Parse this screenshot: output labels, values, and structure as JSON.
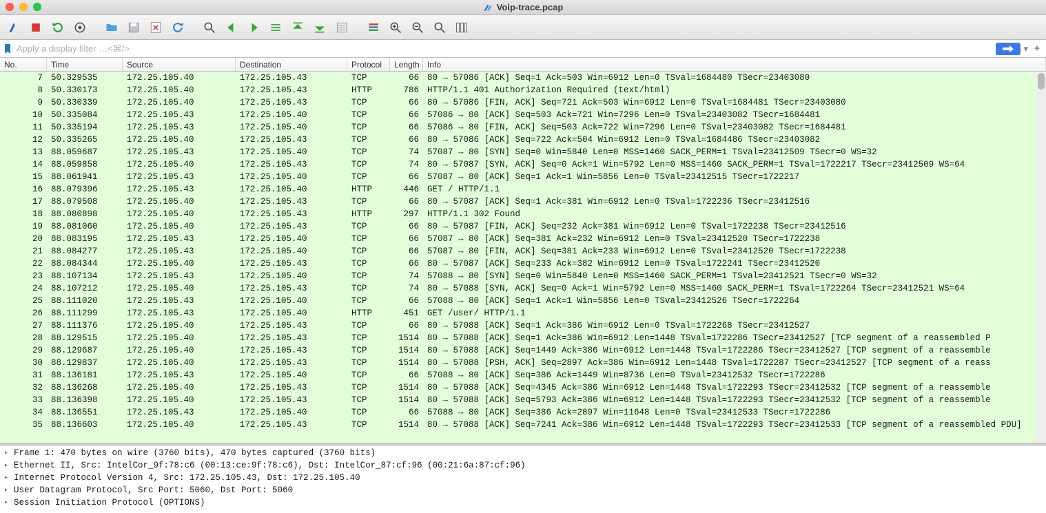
{
  "window": {
    "title": "Voip-trace.pcap"
  },
  "filter": {
    "placeholder": "Apply a display filter …<⌘/>"
  },
  "columns": {
    "no": "No.",
    "time": "Time",
    "source": "Source",
    "destination": "Destination",
    "protocol": "Protocol",
    "length": "Length",
    "info": "Info"
  },
  "packets": [
    {
      "no": 7,
      "time": "50.329535",
      "src": "172.25.105.40",
      "dst": "172.25.105.43",
      "proto": "TCP",
      "len": 66,
      "info": "80 → 57086 [ACK] Seq=1 Ack=503 Win=6912 Len=0 TSval=1684480 TSecr=23403080"
    },
    {
      "no": 8,
      "time": "50.330173",
      "src": "172.25.105.40",
      "dst": "172.25.105.43",
      "proto": "HTTP",
      "len": 786,
      "info": "HTTP/1.1 401 Authorization Required  (text/html)"
    },
    {
      "no": 9,
      "time": "50.330339",
      "src": "172.25.105.40",
      "dst": "172.25.105.43",
      "proto": "TCP",
      "len": 66,
      "info": "80 → 57086 [FIN, ACK] Seq=721 Ack=503 Win=6912 Len=0 TSval=1684481 TSecr=23403080"
    },
    {
      "no": 10,
      "time": "50.335084",
      "src": "172.25.105.43",
      "dst": "172.25.105.40",
      "proto": "TCP",
      "len": 66,
      "info": "57086 → 80 [ACK] Seq=503 Ack=721 Win=7296 Len=0 TSval=23403082 TSecr=1684481"
    },
    {
      "no": 11,
      "time": "50.335194",
      "src": "172.25.105.43",
      "dst": "172.25.105.40",
      "proto": "TCP",
      "len": 66,
      "info": "57086 → 80 [FIN, ACK] Seq=503 Ack=722 Win=7296 Len=0 TSval=23403082 TSecr=1684481"
    },
    {
      "no": 12,
      "time": "50.335265",
      "src": "172.25.105.40",
      "dst": "172.25.105.43",
      "proto": "TCP",
      "len": 66,
      "info": "80 → 57086 [ACK] Seq=722 Ack=504 Win=6912 Len=0 TSval=1684486 TSecr=23403082"
    },
    {
      "no": 13,
      "time": "88.059687",
      "src": "172.25.105.43",
      "dst": "172.25.105.40",
      "proto": "TCP",
      "len": 74,
      "info": "57087 → 80 [SYN] Seq=0 Win=5840 Len=0 MSS=1460 SACK_PERM=1 TSval=23412509 TSecr=0 WS=32"
    },
    {
      "no": 14,
      "time": "88.059858",
      "src": "172.25.105.40",
      "dst": "172.25.105.43",
      "proto": "TCP",
      "len": 74,
      "info": "80 → 57087 [SYN, ACK] Seq=0 Ack=1 Win=5792 Len=0 MSS=1460 SACK_PERM=1 TSval=1722217 TSecr=23412509 WS=64"
    },
    {
      "no": 15,
      "time": "88.061941",
      "src": "172.25.105.43",
      "dst": "172.25.105.40",
      "proto": "TCP",
      "len": 66,
      "info": "57087 → 80 [ACK] Seq=1 Ack=1 Win=5856 Len=0 TSval=23412515 TSecr=1722217"
    },
    {
      "no": 16,
      "time": "88.079396",
      "src": "172.25.105.43",
      "dst": "172.25.105.40",
      "proto": "HTTP",
      "len": 446,
      "info": "GET / HTTP/1.1"
    },
    {
      "no": 17,
      "time": "88.079508",
      "src": "172.25.105.40",
      "dst": "172.25.105.43",
      "proto": "TCP",
      "len": 66,
      "info": "80 → 57087 [ACK] Seq=1 Ack=381 Win=6912 Len=0 TSval=1722236 TSecr=23412516"
    },
    {
      "no": 18,
      "time": "88.080898",
      "src": "172.25.105.40",
      "dst": "172.25.105.43",
      "proto": "HTTP",
      "len": 297,
      "info": "HTTP/1.1 302 Found"
    },
    {
      "no": 19,
      "time": "88.081060",
      "src": "172.25.105.40",
      "dst": "172.25.105.43",
      "proto": "TCP",
      "len": 66,
      "info": "80 → 57087 [FIN, ACK] Seq=232 Ack=381 Win=6912 Len=0 TSval=1722238 TSecr=23412516"
    },
    {
      "no": 20,
      "time": "88.083195",
      "src": "172.25.105.43",
      "dst": "172.25.105.40",
      "proto": "TCP",
      "len": 66,
      "info": "57087 → 80 [ACK] Seq=381 Ack=232 Win=6912 Len=0 TSval=23412520 TSecr=1722238"
    },
    {
      "no": 21,
      "time": "88.084277",
      "src": "172.25.105.43",
      "dst": "172.25.105.40",
      "proto": "TCP",
      "len": 66,
      "info": "57087 → 80 [FIN, ACK] Seq=381 Ack=233 Win=6912 Len=0 TSval=23412520 TSecr=1722238"
    },
    {
      "no": 22,
      "time": "88.084344",
      "src": "172.25.105.40",
      "dst": "172.25.105.43",
      "proto": "TCP",
      "len": 66,
      "info": "80 → 57087 [ACK] Seq=233 Ack=382 Win=6912 Len=0 TSval=1722241 TSecr=23412520"
    },
    {
      "no": 23,
      "time": "88.107134",
      "src": "172.25.105.43",
      "dst": "172.25.105.40",
      "proto": "TCP",
      "len": 74,
      "info": "57088 → 80 [SYN] Seq=0 Win=5840 Len=0 MSS=1460 SACK_PERM=1 TSval=23412521 TSecr=0 WS=32"
    },
    {
      "no": 24,
      "time": "88.107212",
      "src": "172.25.105.40",
      "dst": "172.25.105.43",
      "proto": "TCP",
      "len": 74,
      "info": "80 → 57088 [SYN, ACK] Seq=0 Ack=1 Win=5792 Len=0 MSS=1460 SACK_PERM=1 TSval=1722264 TSecr=23412521 WS=64"
    },
    {
      "no": 25,
      "time": "88.111020",
      "src": "172.25.105.43",
      "dst": "172.25.105.40",
      "proto": "TCP",
      "len": 66,
      "info": "57088 → 80 [ACK] Seq=1 Ack=1 Win=5856 Len=0 TSval=23412526 TSecr=1722264"
    },
    {
      "no": 26,
      "time": "88.111299",
      "src": "172.25.105.43",
      "dst": "172.25.105.40",
      "proto": "HTTP",
      "len": 451,
      "info": "GET /user/ HTTP/1.1"
    },
    {
      "no": 27,
      "time": "88.111376",
      "src": "172.25.105.40",
      "dst": "172.25.105.43",
      "proto": "TCP",
      "len": 66,
      "info": "80 → 57088 [ACK] Seq=1 Ack=386 Win=6912 Len=0 TSval=1722268 TSecr=23412527"
    },
    {
      "no": 28,
      "time": "88.129515",
      "src": "172.25.105.40",
      "dst": "172.25.105.43",
      "proto": "TCP",
      "len": 1514,
      "info": "80 → 57088 [ACK] Seq=1 Ack=386 Win=6912 Len=1448 TSval=1722286 TSecr=23412527 [TCP segment of a reassembled P"
    },
    {
      "no": 29,
      "time": "88.129687",
      "src": "172.25.105.40",
      "dst": "172.25.105.43",
      "proto": "TCP",
      "len": 1514,
      "info": "80 → 57088 [ACK] Seq=1449 Ack=386 Win=6912 Len=1448 TSval=1722286 TSecr=23412527 [TCP segment of a reassemble"
    },
    {
      "no": 30,
      "time": "88.129837",
      "src": "172.25.105.40",
      "dst": "172.25.105.43",
      "proto": "TCP",
      "len": 1514,
      "info": "80 → 57088 [PSH, ACK] Seq=2897 Ack=386 Win=6912 Len=1448 TSval=1722287 TSecr=23412527 [TCP segment of a reass"
    },
    {
      "no": 31,
      "time": "88.136181",
      "src": "172.25.105.43",
      "dst": "172.25.105.40",
      "proto": "TCP",
      "len": 66,
      "info": "57088 → 80 [ACK] Seq=386 Ack=1449 Win=8736 Len=0 TSval=23412532 TSecr=1722286"
    },
    {
      "no": 32,
      "time": "88.136268",
      "src": "172.25.105.40",
      "dst": "172.25.105.43",
      "proto": "TCP",
      "len": 1514,
      "info": "80 → 57088 [ACK] Seq=4345 Ack=386 Win=6912 Len=1448 TSval=1722293 TSecr=23412532 [TCP segment of a reassemble"
    },
    {
      "no": 33,
      "time": "88.136398",
      "src": "172.25.105.40",
      "dst": "172.25.105.43",
      "proto": "TCP",
      "len": 1514,
      "info": "80 → 57088 [ACK] Seq=5793 Ack=386 Win=6912 Len=1448 TSval=1722293 TSecr=23412532 [TCP segment of a reassemble"
    },
    {
      "no": 34,
      "time": "88.136551",
      "src": "172.25.105.43",
      "dst": "172.25.105.40",
      "proto": "TCP",
      "len": 66,
      "info": "57088 → 80 [ACK] Seq=386 Ack=2897 Win=11648 Len=0 TSval=23412533 TSecr=1722286"
    },
    {
      "no": 35,
      "time": "88.136603",
      "src": "172.25.105.40",
      "dst": "172.25.105.43",
      "proto": "TCP",
      "len": 1514,
      "info": "80 → 57088 [ACK] Seq=7241 Ack=386 Win=6912 Len=1448 TSval=1722293 TSecr=23412533 [TCP segment of a reassembled PDU]"
    }
  ],
  "detail_tree": [
    "Frame 1: 470 bytes on wire (3760 bits), 470 bytes captured (3760 bits)",
    "Ethernet II, Src: IntelCor_9f:78:c6 (00:13:ce:9f:78:c6), Dst: IntelCor_87:cf:96 (00:21:6a:87:cf:96)",
    "Internet Protocol Version 4, Src: 172.25.105.43, Dst: 172.25.105.40",
    "User Datagram Protocol, Src Port: 5060, Dst Port: 5060",
    "Session Initiation Protocol (OPTIONS)"
  ]
}
